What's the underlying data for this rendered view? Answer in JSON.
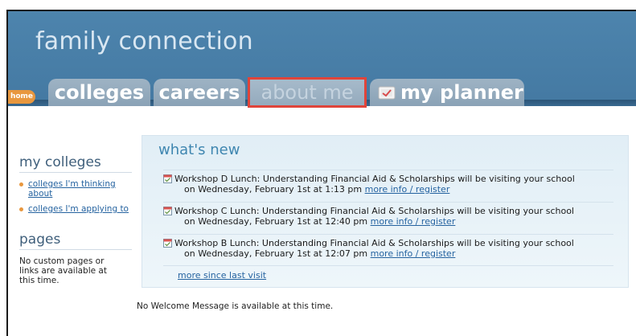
{
  "header": {
    "title": "family connection"
  },
  "tabs": {
    "home": "home",
    "colleges": "colleges",
    "careers": "careers",
    "about_me": "about me",
    "my_planner": "my planner"
  },
  "sidebar": {
    "my_colleges_heading": "my colleges",
    "links": [
      "colleges I'm thinking about",
      "colleges I'm applying to"
    ],
    "pages_heading": "pages",
    "pages_note": "No custom pages or links are available at this time."
  },
  "whats_new": {
    "heading": "what's new",
    "items": [
      {
        "line1": "Workshop D Lunch: Understanding Financial Aid & Scholarships will be visiting your school",
        "line2": "on Wednesday, February 1st at 1:13 pm",
        "link": "more info / register"
      },
      {
        "line1": "Workshop C Lunch: Understanding Financial Aid & Scholarships will be visiting your school",
        "line2": "on Wednesday, February 1st at 12:40 pm",
        "link": "more info / register"
      },
      {
        "line1": "Workshop B Lunch: Understanding Financial Aid & Scholarships will be visiting your school",
        "line2": "on Wednesday, February 1st at 12:07 pm",
        "link": "more info / register"
      }
    ],
    "more_link": "more since last visit"
  },
  "welcome_message": "No Welcome Message is available at this time.",
  "colors": {
    "header_blue": "#4d84ad",
    "tab_gray": "#9eb3c4",
    "highlight_red": "#e0443a",
    "home_orange": "#e8973e",
    "link_blue": "#2563a0"
  },
  "icons": {
    "planner": "planner-icon",
    "event": "calendar-icon"
  }
}
